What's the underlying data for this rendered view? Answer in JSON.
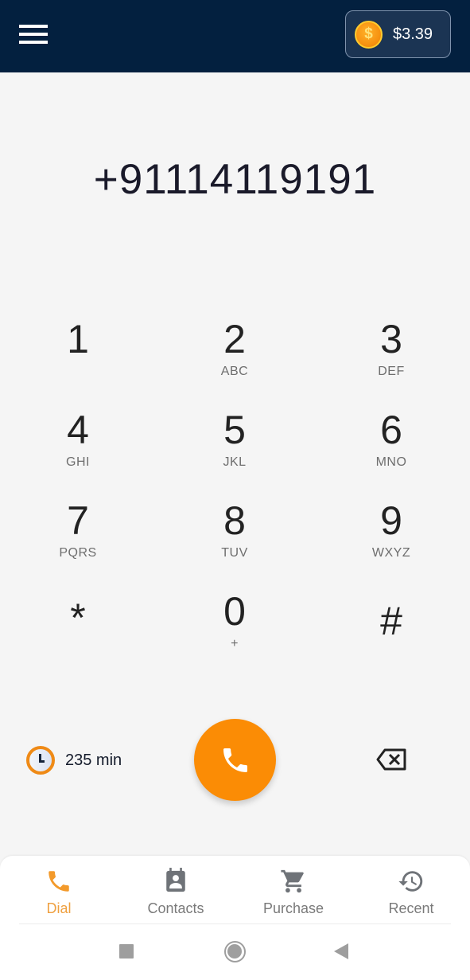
{
  "header": {
    "menu_icon": "hamburger-menu-icon",
    "balance_icon": "coin-dollar-icon",
    "balance": "$3.39"
  },
  "dialer": {
    "number": "+91114119191",
    "keys": [
      {
        "digit": "1",
        "letters": ""
      },
      {
        "digit": "2",
        "letters": "ABC"
      },
      {
        "digit": "3",
        "letters": "DEF"
      },
      {
        "digit": "4",
        "letters": "GHI"
      },
      {
        "digit": "5",
        "letters": "JKL"
      },
      {
        "digit": "6",
        "letters": "MNO"
      },
      {
        "digit": "7",
        "letters": "PQRS"
      },
      {
        "digit": "8",
        "letters": "TUV"
      },
      {
        "digit": "9",
        "letters": "WXYZ"
      },
      {
        "digit": "*",
        "letters": ""
      },
      {
        "digit": "0",
        "letters": "+"
      },
      {
        "digit": "#",
        "letters": ""
      }
    ]
  },
  "actions": {
    "minutes_icon": "clock-icon",
    "minutes": "235 min",
    "call_icon": "phone-icon",
    "backspace_icon": "backspace-icon",
    "call_color": "#fb8c05"
  },
  "bottom_nav": {
    "active": "Dial",
    "accent": "#f39a2b",
    "items": [
      {
        "label": "Dial",
        "icon": "phone-icon"
      },
      {
        "label": "Contacts",
        "icon": "contact-card-icon"
      },
      {
        "label": "Purchase",
        "icon": "cart-icon"
      },
      {
        "label": "Recent",
        "icon": "history-icon"
      }
    ]
  },
  "system_nav": {
    "items": [
      "recents-square-icon",
      "home-circle-icon",
      "back-triangle-icon"
    ]
  }
}
